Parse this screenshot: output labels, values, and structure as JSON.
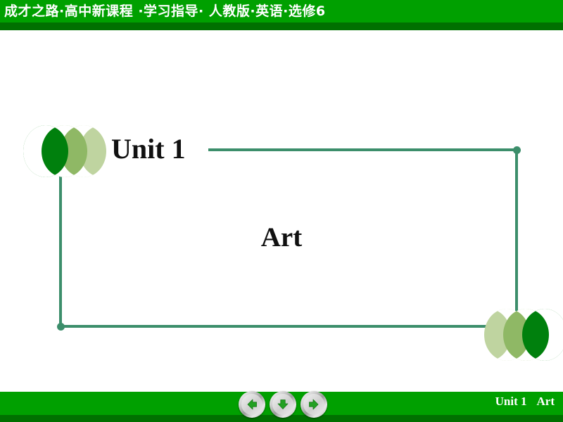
{
  "header": {
    "title": "成才之路·高中新课程 ·学习指导· 人教版·英语·选修6",
    "band_color": "#00a000",
    "band_shadow_color": "#007000"
  },
  "slide": {
    "unit_title": "Unit 1",
    "subject_title": "Art",
    "frame_color": "#3c8e6b",
    "chevron_left": {
      "name": "left-chevron-decoration",
      "colors": [
        "#00800d",
        "#8fb865",
        "#bfd4a0"
      ]
    },
    "chevron_right": {
      "name": "right-chevron-decoration",
      "colors": [
        "#bfd4a0",
        "#8fb865",
        "#00800d"
      ]
    }
  },
  "footer": {
    "unit_label": "Unit 1",
    "subject_label": "Art",
    "band_color": "#00a000",
    "band_shadow_color": "#007000",
    "nav": {
      "prev_icon": "arrow-left-icon",
      "home_icon": "arrow-down-icon",
      "next_icon": "arrow-right-icon",
      "arrow_color": "#22a022"
    }
  }
}
